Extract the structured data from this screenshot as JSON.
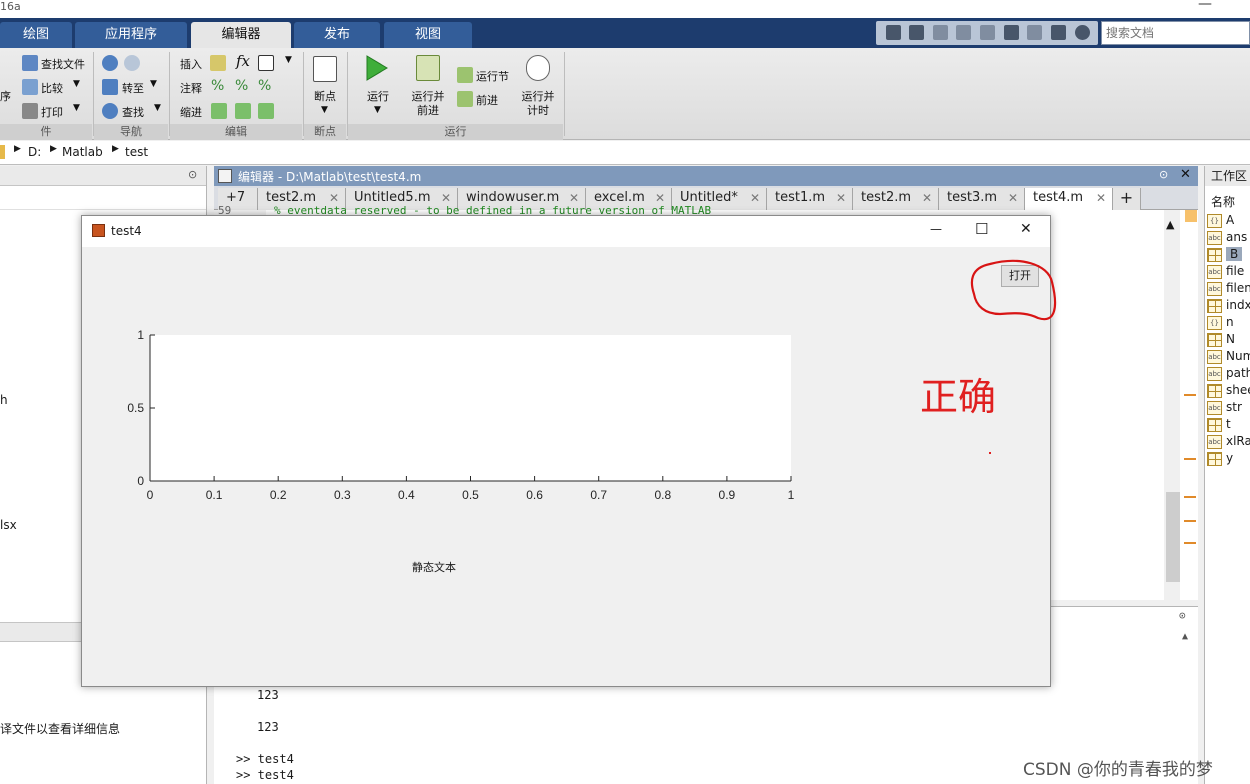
{
  "window": {
    "title": "16a",
    "minimize": "—"
  },
  "ribbon_tabs": [
    "绘图",
    "应用程序",
    "编辑器",
    "发布",
    "视图"
  ],
  "search": {
    "placeholder": "搜索文档"
  },
  "ribbon": {
    "file": {
      "find_files": "查找文件",
      "compare": "比较",
      "print": "打印",
      "left_frag_1": "序"
    },
    "nav": {
      "goto": "转至",
      "find": "查找"
    },
    "edit": {
      "insert": "插入",
      "comment": "注释",
      "indent": "缩进",
      "fx": "fx"
    },
    "breakpoints": {
      "label": "断点"
    },
    "run": {
      "run": "运行",
      "run_advance": "运行并\n前进",
      "run_section": "运行节",
      "advance": "前进",
      "run_timed": "运行并\n计时"
    },
    "groups": {
      "file": "件",
      "nav": "导航",
      "edit": "编辑",
      "breakpoints": "断点",
      "run": "运行"
    }
  },
  "address": {
    "segments": [
      "D:",
      "Matlab",
      "test"
    ]
  },
  "left_panel": {
    "frag_h": "h",
    "frag_xlsx": "lsx",
    "hint": "译文件以查看详细信息"
  },
  "editor": {
    "title": "编辑器 - D:\\Matlab\\test\\test4.m",
    "overflow_tab": "+7",
    "tabs": [
      {
        "label": "test2.m",
        "active": false
      },
      {
        "label": "Untitled5.m",
        "active": false
      },
      {
        "label": "windowuser.m",
        "active": false
      },
      {
        "label": "excel.m",
        "active": false
      },
      {
        "label": "Untitled*",
        "active": false
      },
      {
        "label": "test1.m",
        "active": false
      },
      {
        "label": "test2.m",
        "active": false
      },
      {
        "label": "test3.m",
        "active": false
      },
      {
        "label": "test4.m",
        "active": true
      }
    ],
    "add_tab": "+",
    "code_fragment": "% eventdata  reserved - to be defined in a future version of MATLAB",
    "line_number": "59"
  },
  "command_window": {
    "lines": [
      "123",
      "123",
      ">> test4",
      ">> test4"
    ]
  },
  "workspace": {
    "title": "工作区",
    "header": "名称",
    "vars": [
      {
        "name": "A",
        "type": "struct"
      },
      {
        "name": "ans",
        "type": "abc"
      },
      {
        "name": "B",
        "type": "grid",
        "selected": true
      },
      {
        "name": "file",
        "type": "abc"
      },
      {
        "name": "filen",
        "type": "abc"
      },
      {
        "name": "indx",
        "type": "grid"
      },
      {
        "name": "n",
        "type": "struct"
      },
      {
        "name": "N",
        "type": "grid"
      },
      {
        "name": "Num",
        "type": "abc"
      },
      {
        "name": "path",
        "type": "abc"
      },
      {
        "name": "shee",
        "type": "grid"
      },
      {
        "name": "str",
        "type": "abc"
      },
      {
        "name": "t",
        "type": "table"
      },
      {
        "name": "xlRa",
        "type": "abc"
      },
      {
        "name": "y",
        "type": "grid"
      }
    ]
  },
  "figure": {
    "title": "test4",
    "open_button": "打开",
    "static_text": "静态文本",
    "annotation": "正确",
    "controls": {
      "minimize": "—",
      "maximize": "☐",
      "close": "✕"
    }
  },
  "chart_data": {
    "type": "line",
    "title": "",
    "xlabel": "",
    "ylabel": "",
    "xlim": [
      0,
      1
    ],
    "ylim": [
      0,
      1
    ],
    "xticks": [
      "0",
      "0.1",
      "0.2",
      "0.3",
      "0.4",
      "0.5",
      "0.6",
      "0.7",
      "0.8",
      "0.9",
      "1"
    ],
    "yticks": [
      "0",
      "0.5",
      "1"
    ],
    "series": []
  },
  "watermark": "CSDN @你的青春我的梦",
  "colors": {
    "accent_tab": "#1d3c6e",
    "annotation": "#e02020",
    "editor_title": "#7f99bb"
  }
}
